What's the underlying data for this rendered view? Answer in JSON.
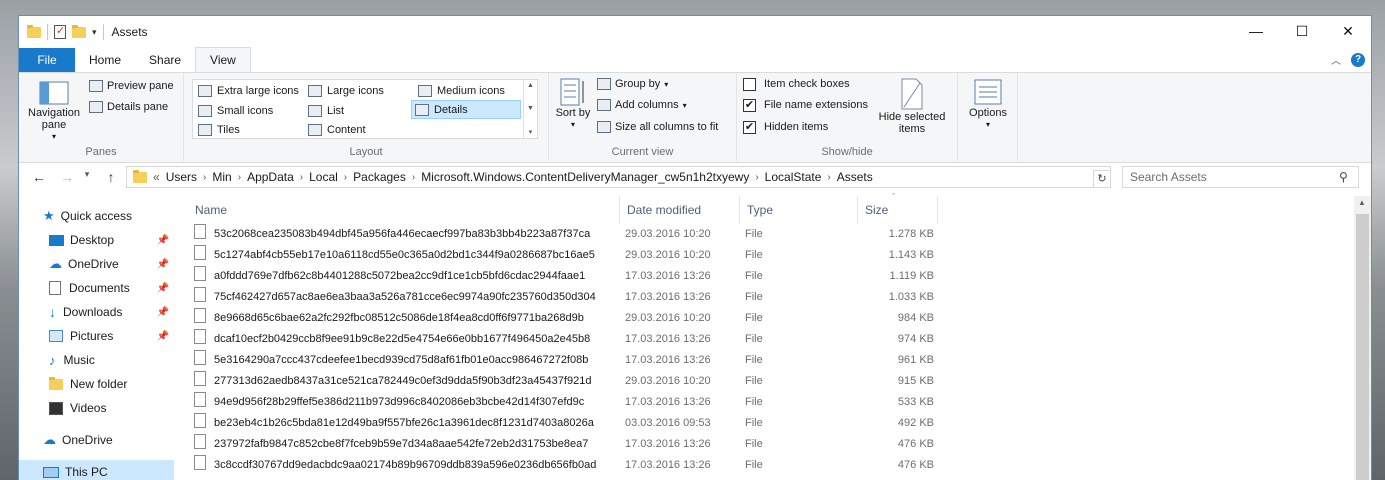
{
  "window": {
    "title": "Assets"
  },
  "controls": {
    "minimize": "—",
    "maximize": "☐",
    "close": "✕"
  },
  "tabs": {
    "file": "File",
    "home": "Home",
    "share": "Share",
    "view": "View"
  },
  "ribbon": {
    "panes": {
      "label": "Panes",
      "navigation_pane": "Navigation pane",
      "preview_pane": "Preview pane",
      "details_pane": "Details pane"
    },
    "layout": {
      "label": "Layout",
      "items": [
        "Extra large icons",
        "Large icons",
        "Medium icons",
        "Small icons",
        "List",
        "Details",
        "Tiles",
        "Content"
      ],
      "selected": "Details"
    },
    "current_view": {
      "label": "Current view",
      "sort_by": "Sort by",
      "group_by": "Group by",
      "add_columns": "Add columns",
      "size_all_columns": "Size all columns to fit"
    },
    "show_hide": {
      "label": "Show/hide",
      "item_check_boxes": "Item check boxes",
      "file_name_extensions": "File name extensions",
      "hidden_items": "Hidden items",
      "hide_selected_items": "Hide selected items",
      "checks": {
        "item_check_boxes": false,
        "file_name_extensions": true,
        "hidden_items": true
      }
    },
    "options": "Options"
  },
  "address": {
    "prefix": "«",
    "crumbs": [
      "Users",
      "Min",
      "AppData",
      "Local",
      "Packages",
      "Microsoft.Windows.ContentDeliveryManager_cw5n1h2txyewy",
      "LocalState",
      "Assets"
    ]
  },
  "search": {
    "placeholder": "Search Assets"
  },
  "nav": [
    {
      "label": "Quick access",
      "icon": "star-icon",
      "pinned": false
    },
    {
      "label": "Desktop",
      "icon": "desktop-icon",
      "pinned": true
    },
    {
      "label": "OneDrive",
      "icon": "cloud-icon",
      "pinned": true
    },
    {
      "label": "Documents",
      "icon": "documents-icon",
      "pinned": true
    },
    {
      "label": "Downloads",
      "icon": "download-icon",
      "pinned": true
    },
    {
      "label": "Pictures",
      "icon": "pictures-icon",
      "pinned": true
    },
    {
      "label": "Music",
      "icon": "music-icon",
      "pinned": false
    },
    {
      "label": "New folder",
      "icon": "folder-icon",
      "pinned": false
    },
    {
      "label": "Videos",
      "icon": "videos-icon",
      "pinned": false
    },
    {
      "label": "OneDrive",
      "icon": "cloud-icon",
      "pinned": false
    },
    {
      "label": "This PC",
      "icon": "pc-icon",
      "pinned": false
    }
  ],
  "columns": {
    "name": "Name",
    "date": "Date modified",
    "type": "Type",
    "size": "Size"
  },
  "files": [
    {
      "name": "53c2068cea235083b494dbf45a956fa446ecaecf997ba83b3bb4b223a87f37ca",
      "date": "29.03.2016 10:20",
      "type": "File",
      "size": "1.278 KB"
    },
    {
      "name": "5c1274abf4cb55eb17e10a6118cd55e0c365a0d2bd1c344f9a0286687bc16ae5",
      "date": "29.03.2016 10:20",
      "type": "File",
      "size": "1.143 KB"
    },
    {
      "name": "a0fddd769e7dfb62c8b4401288c5072bea2cc9df1ce1cb5bfd6cdac2944faae1",
      "date": "17.03.2016 13:26",
      "type": "File",
      "size": "1.119 KB"
    },
    {
      "name": "75cf462427d657ac8ae6ea3baa3a526a781cce6ec9974a90fc235760d350d304",
      "date": "17.03.2016 13:26",
      "type": "File",
      "size": "1.033 KB"
    },
    {
      "name": "8e9668d65c6bae62a2fc292fbc08512c5086de18f4ea8cd0ff6f9771ba268d9b",
      "date": "29.03.2016 10:20",
      "type": "File",
      "size": "984 KB"
    },
    {
      "name": "dcaf10ecf2b0429ccb8f9ee91b9c8e22d5e4754e66e0bb1677f496450a2e45b8",
      "date": "17.03.2016 13:26",
      "type": "File",
      "size": "974 KB"
    },
    {
      "name": "5e3164290a7ccc437cdeefee1becd939cd75d8af61fb01e0acc986467272f08b",
      "date": "17.03.2016 13:26",
      "type": "File",
      "size": "961 KB"
    },
    {
      "name": "277313d62aedb8437a31ce521ca782449c0ef3d9dda5f90b3df23a45437f921d",
      "date": "29.03.2016 10:20",
      "type": "File",
      "size": "915 KB"
    },
    {
      "name": "94e9d956f28b29ffef5e386d211b973d996c8402086eb3bcbe42d14f307efd9c",
      "date": "17.03.2016 13:26",
      "type": "File",
      "size": "533 KB"
    },
    {
      "name": "be23eb4c1b26c5bda81e12d49ba9f557bfe26c1a3961dec8f1231d7403a8026a",
      "date": "03.03.2016 09:53",
      "type": "File",
      "size": "492 KB"
    },
    {
      "name": "237972fafb9847c852cbe8f7fceb9b59e7d34a8aae542fe72eb2d31753be8ea7",
      "date": "17.03.2016 13:26",
      "type": "File",
      "size": "476 KB"
    },
    {
      "name": "3c8ccdf30767dd9edacbdc9aa02174b89b96709ddb839a596e0236db656fb0ad",
      "date": "17.03.2016 13:26",
      "type": "File",
      "size": "476 KB"
    }
  ]
}
